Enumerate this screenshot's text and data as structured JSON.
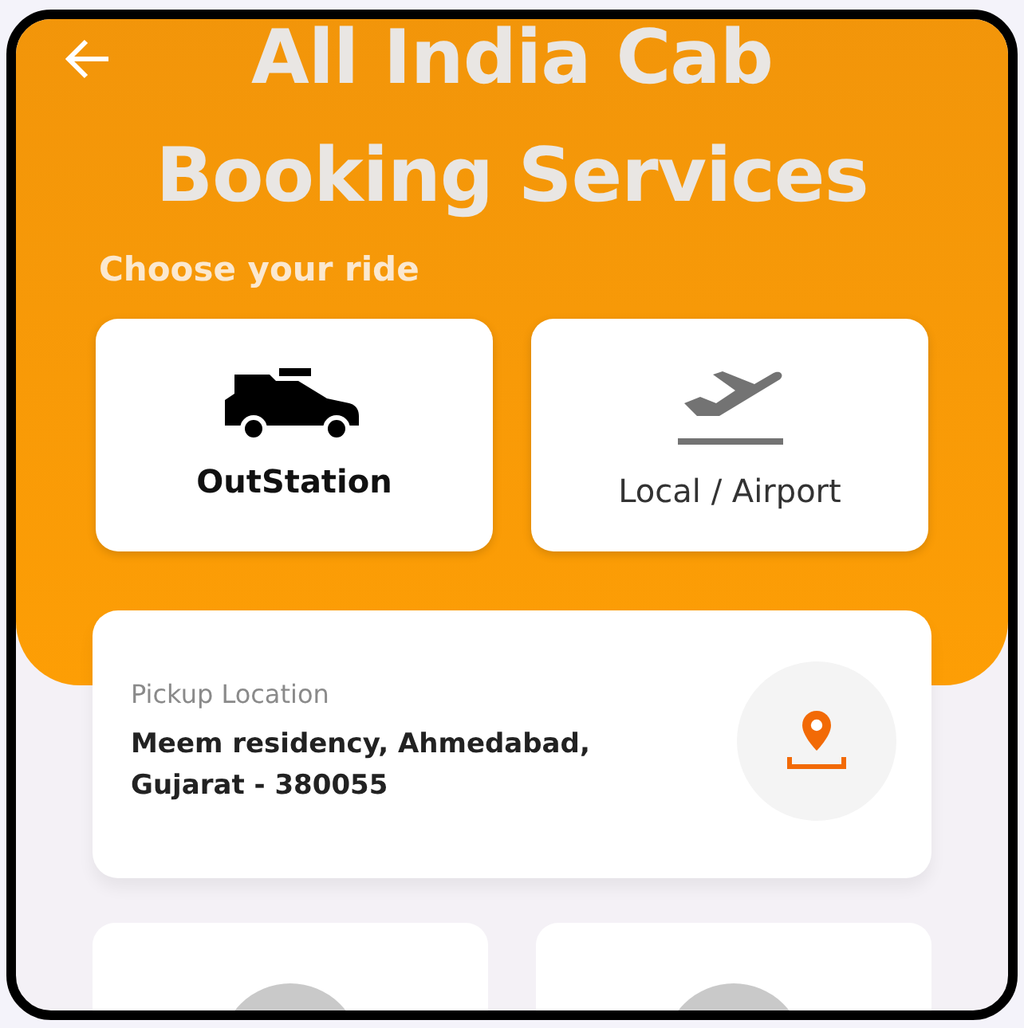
{
  "header": {
    "title": "All India Cab Booking Services",
    "subtitle": "Choose your ride"
  },
  "rides": [
    {
      "label": "OutStation",
      "kind": "car",
      "selected": true
    },
    {
      "label": "Local / Airport",
      "kind": "plane",
      "selected": false
    }
  ],
  "pickup": {
    "label": "Pickup Location",
    "address": "Meem residency, Ahmedabad, Gujarat - 380055"
  }
}
